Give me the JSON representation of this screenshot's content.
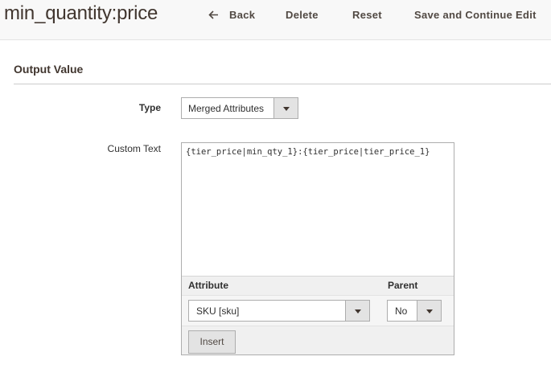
{
  "header": {
    "title": "min_quantity:price",
    "back_label": "Back",
    "delete_label": "Delete",
    "reset_label": "Reset",
    "save_continue_label": "Save and Continue Edit"
  },
  "section": {
    "title": "Output Value"
  },
  "form": {
    "type_label": "Type",
    "type_value": "Merged Attributes",
    "custom_text_label": "Custom Text",
    "custom_text_value": "{tier_price|min_qty_1}:{tier_price|tier_price_1}",
    "attribute_header": "Attribute",
    "parent_header": "Parent",
    "attribute_value": "SKU [sku]",
    "parent_value": "No",
    "insert_label": "Insert"
  },
  "colors": {
    "header_bg": "#f8f8f8",
    "title_color": "#41362f",
    "button_text": "#514943",
    "border": "#adadad",
    "panel_bg": "#f0f0f0"
  },
  "icons": {
    "back": "arrow-left-icon",
    "dropdown": "chevron-down-icon"
  }
}
